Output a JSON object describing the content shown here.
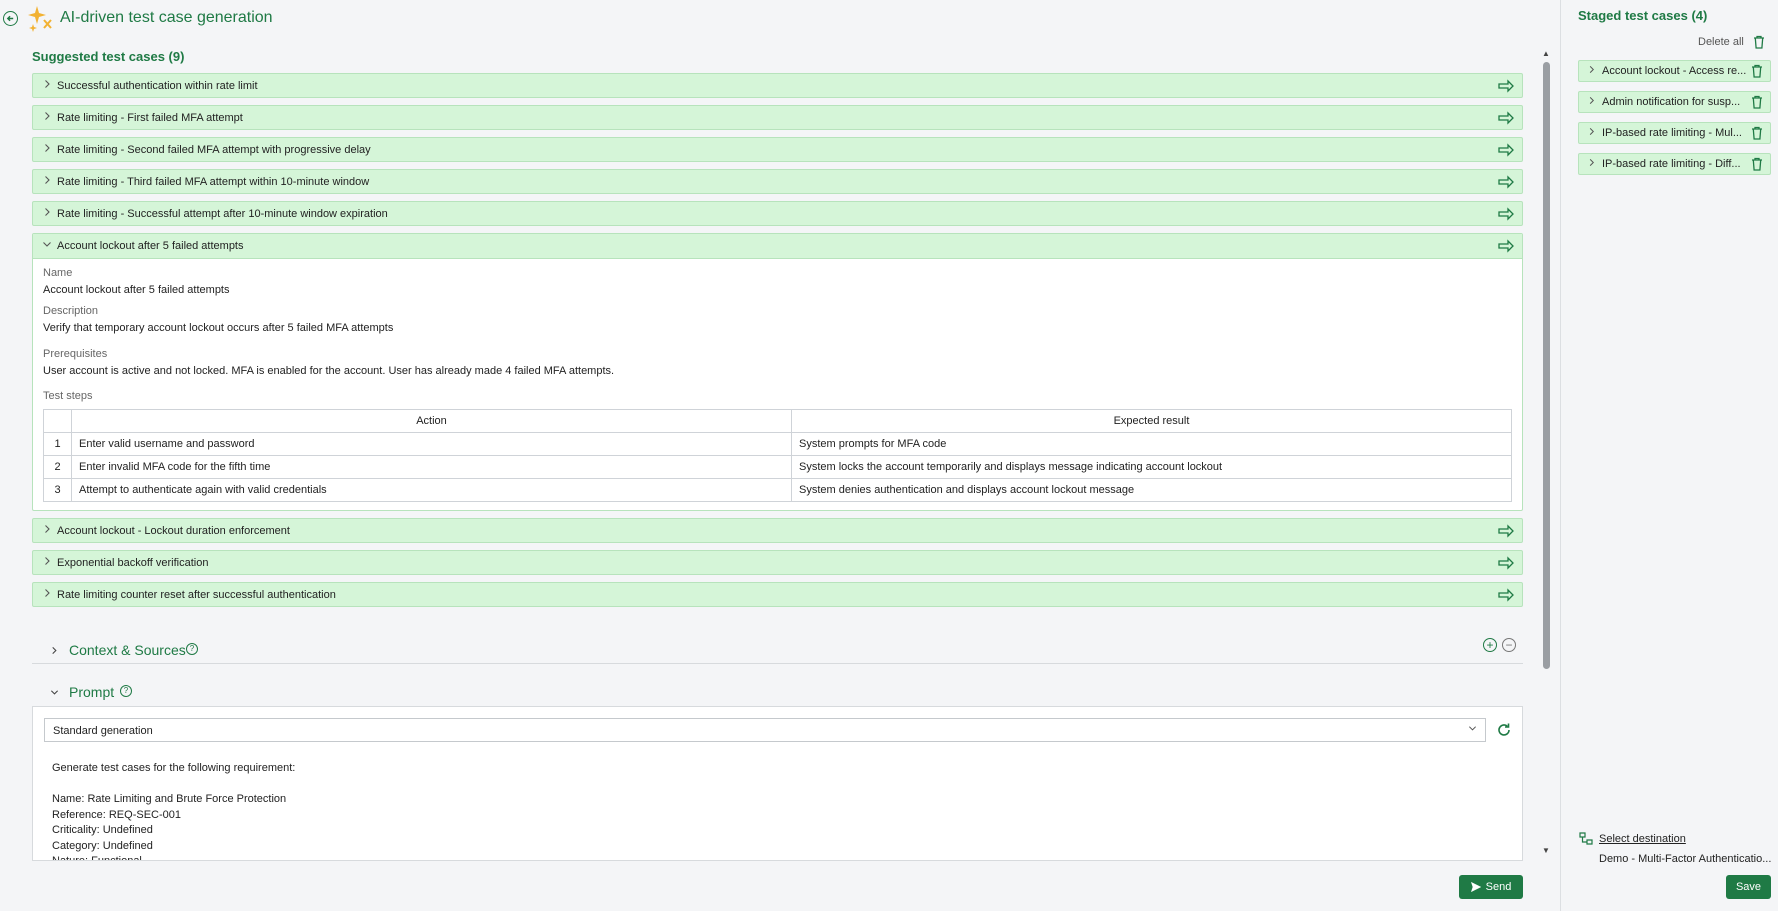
{
  "header": {
    "title": "AI-driven test case generation",
    "back_icon": "arrow-left-circle-icon",
    "logo_icon": "sparkles-icon"
  },
  "suggested": {
    "title": "Suggested test cases (9)",
    "items_before": [
      "Successful authentication within rate limit",
      "Rate limiting - First failed MFA attempt",
      "Rate limiting - Second failed MFA attempt with progressive delay",
      "Rate limiting - Third failed MFA attempt within 10-minute window",
      "Rate limiting - Successful attempt after 10-minute window expiration"
    ],
    "expanded": {
      "label": "Account lockout after 5 failed attempts",
      "name_label": "Name",
      "name_value": "Account lockout after 5 failed attempts",
      "description_label": "Description",
      "description_value": "Verify that temporary account lockout occurs after 5 failed MFA attempts",
      "prerequisites_label": "Prerequisites",
      "prerequisites_value": "User account is active and not locked. MFA is enabled for the account. User has already made 4 failed MFA attempts.",
      "steps_label": "Test steps",
      "columns": [
        "Action",
        "Expected result"
      ],
      "steps": [
        {
          "num": "1",
          "action": "Enter valid username and password",
          "expected": "System prompts for MFA code"
        },
        {
          "num": "2",
          "action": "Enter invalid MFA code for the fifth time",
          "expected": "System locks the account temporarily and displays message indicating account lockout"
        },
        {
          "num": "3",
          "action": "Attempt to authenticate again with valid credentials",
          "expected": "System denies authentication and displays account lockout message"
        }
      ]
    },
    "items_after": [
      "Account lockout - Lockout duration enforcement",
      "Exponential backoff verification",
      "Rate limiting counter reset after successful authentication"
    ]
  },
  "context": {
    "title": "Context & Sources"
  },
  "prompt": {
    "title": "Prompt",
    "select_value": "Standard generation",
    "text": "Generate test cases for the following requirement:\n\nName: Rate Limiting and Brute Force Protection\nReference: REQ-SEC-001\nCriticality: Undefined\nCategory: Undefined\nNature: Functional",
    "send_label": "Send"
  },
  "staged": {
    "title": "Staged test cases (4)",
    "delete_all_label": "Delete all",
    "items": [
      "Account lockout - Access re...",
      "Admin notification for susp...",
      "IP-based rate limiting - Mul...",
      "IP-based rate limiting - Diff..."
    ],
    "select_destination_label": "Select destination",
    "destination_value": "Demo - Multi-Factor Authenticatio...",
    "save_label": "Save"
  },
  "colors": {
    "accent": "#1f7a45",
    "row_bg": "#d5f5d8",
    "row_border": "#b7e3bc"
  }
}
